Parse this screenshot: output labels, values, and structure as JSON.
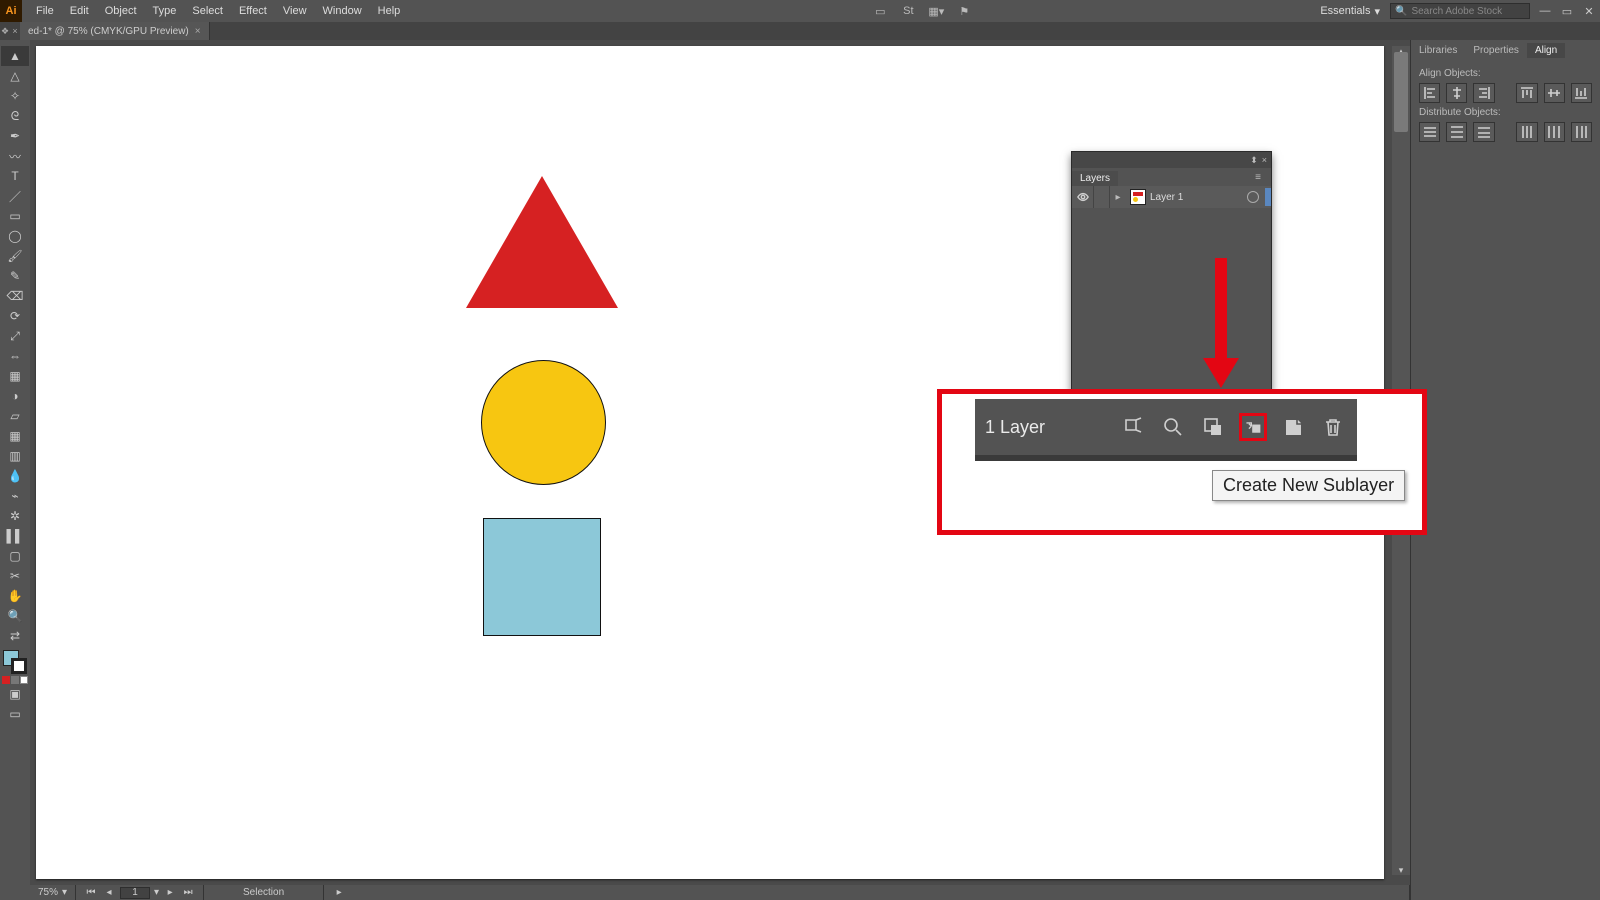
{
  "menubar": {
    "app_initials": "Ai",
    "items": [
      "File",
      "Edit",
      "Object",
      "Type",
      "Select",
      "Effect",
      "View",
      "Window",
      "Help"
    ],
    "workspace_label": "Essentials",
    "search_placeholder": "Search Adobe Stock"
  },
  "doc_tab": {
    "title": "ed-1* @ 75% (CMYK/GPU Preview)"
  },
  "tools": [
    "selection",
    "direct-selection",
    "magic-wand",
    "lasso",
    "pen",
    "curvature",
    "type",
    "line",
    "rectangle",
    "ellipse",
    "paintbrush",
    "pencil",
    "eraser",
    "rotate",
    "scale",
    "width",
    "free-transform",
    "shape-builder",
    "perspective",
    "mesh",
    "gradient",
    "eyedropper",
    "blend",
    "symbol-sprayer",
    "column-graph",
    "artboard",
    "slice",
    "hand",
    "zoom"
  ],
  "layers_panel": {
    "title": "Layers",
    "row": {
      "name": "Layer 1"
    }
  },
  "right_dock": {
    "tabs": [
      "Libraries",
      "Properties",
      "Align"
    ],
    "align_objects_label": "Align Objects:",
    "distribute_objects_label": "Distribute Objects:"
  },
  "status": {
    "zoom": "75%",
    "page": "1",
    "tool": "Selection"
  },
  "callout": {
    "layer_count": "1 Layer",
    "tooltip": "Create New Sublayer"
  },
  "shapes": {
    "triangle_color": "#d62122",
    "circle_color": "#f7c611",
    "square_color": "#8cc8d8"
  }
}
